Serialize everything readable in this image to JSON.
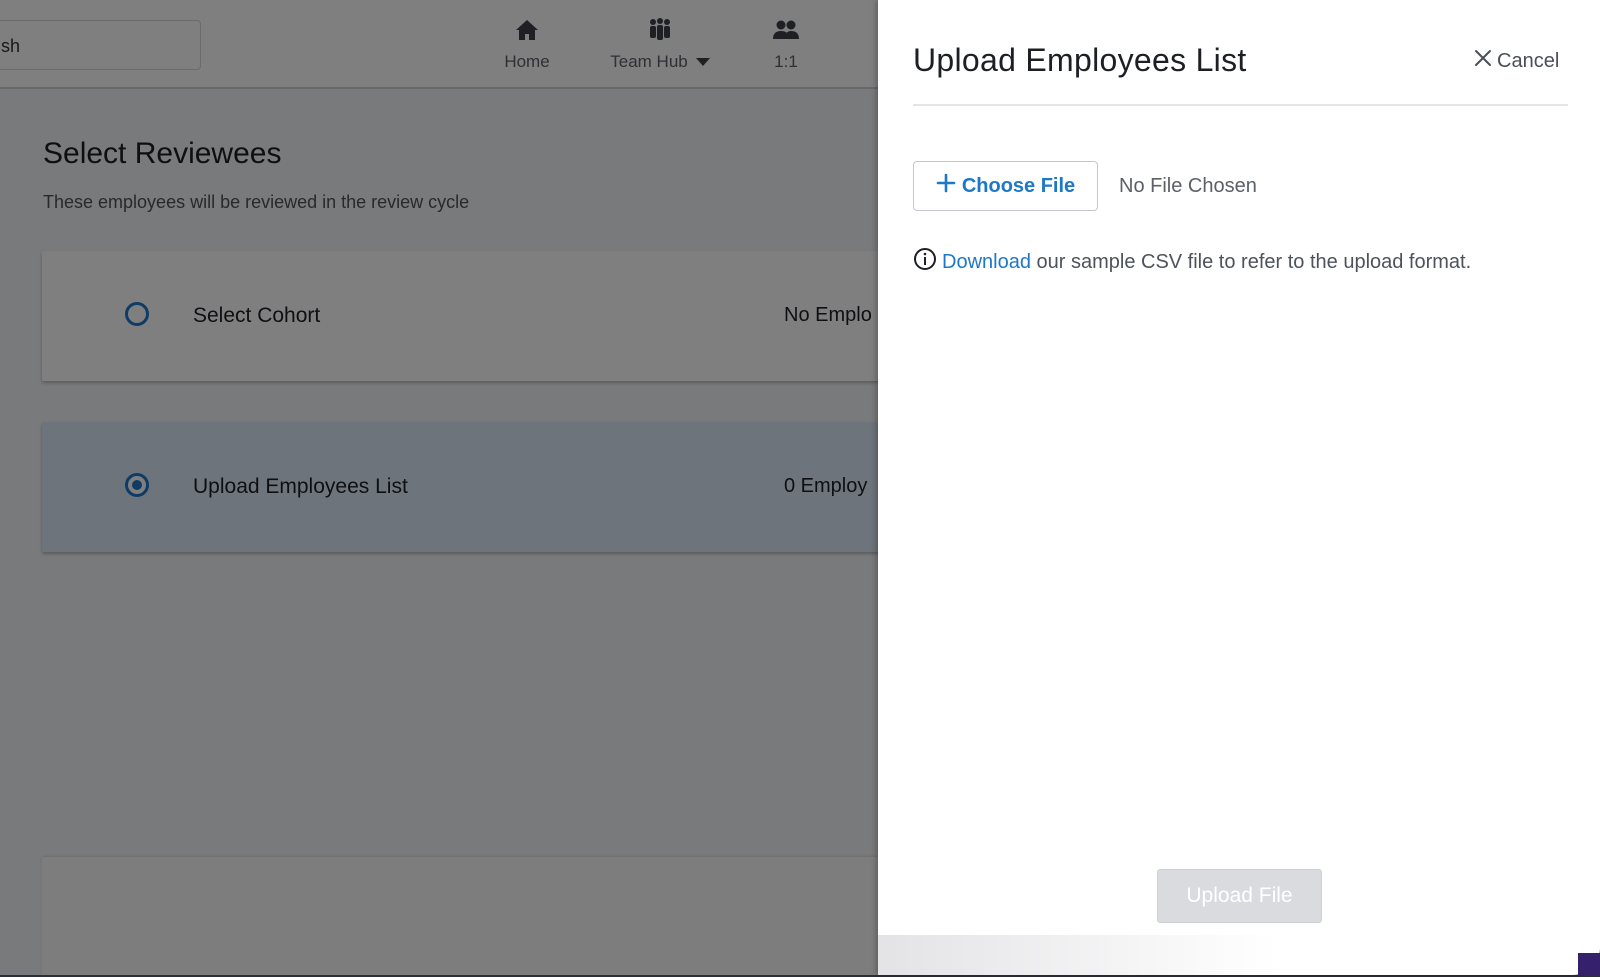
{
  "topbar": {
    "search_value": "sh",
    "nav": [
      {
        "label": "Home",
        "icon": "home-icon"
      },
      {
        "label": "Team Hub",
        "icon": "team-icon"
      },
      {
        "label": "1:1",
        "icon": "people-icon"
      }
    ]
  },
  "main": {
    "title": "Select Reviewees",
    "subtitle": "These employees will be reviewed in the review cycle",
    "options": [
      {
        "label": "Select Cohort",
        "count": "No Emplo",
        "selected": false
      },
      {
        "label": "Upload Employees List",
        "count": "0 Employ",
        "selected": true
      }
    ]
  },
  "drawer": {
    "title": "Upload Employees List",
    "cancel_label": "Cancel",
    "choose_file_label": "Choose File",
    "file_status": "No File Chosen",
    "info_link": "Download",
    "info_text": " our sample CSV file to refer to the upload format.",
    "upload_button": "Upload File"
  },
  "colors": {
    "accent": "#1d78c8",
    "disabled": "#d9dbde",
    "overlay": "rgba(0,0,0,0.5)"
  }
}
